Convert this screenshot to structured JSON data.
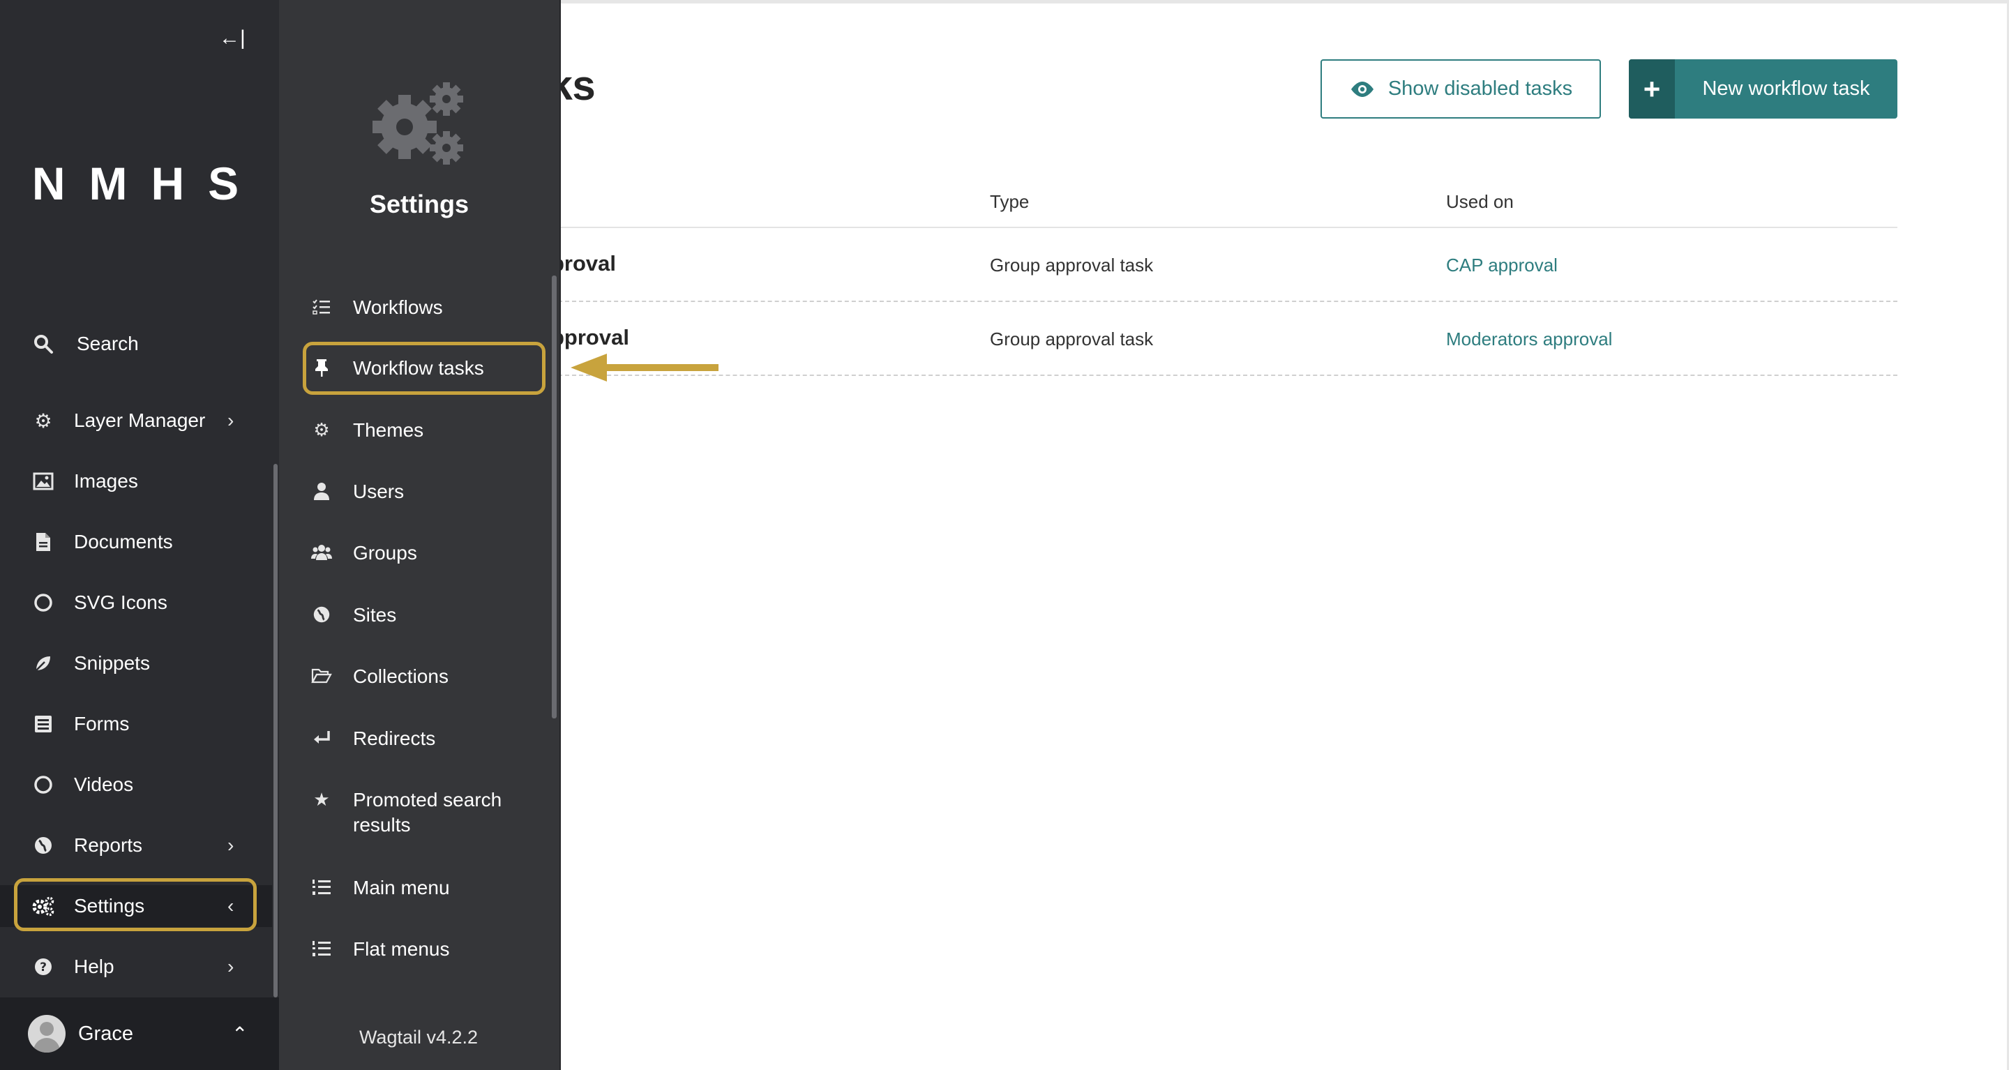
{
  "page": {
    "title": "w tasks",
    "show_disabled_label": "Show disabled tasks",
    "new_task_label": "New workflow task",
    "new_task_icon": "+"
  },
  "table": {
    "columns": [
      "Type",
      "Used on"
    ],
    "rows": [
      {
        "name": "proval",
        "type": "Group approval task",
        "used_on": "CAP approval"
      },
      {
        "name": "pproval",
        "type": "Group approval task",
        "used_on": "Moderators approval"
      }
    ]
  },
  "sidebar": {
    "collapse_icon": "←|",
    "logo": "NMHS",
    "items": [
      {
        "label": "Search",
        "icon": "search-icon"
      },
      {
        "label": "Layer Manager",
        "icon": "gear-icon",
        "chevron": "›"
      },
      {
        "label": "Images",
        "icon": "image-icon"
      },
      {
        "label": "Documents",
        "icon": "document-icon"
      },
      {
        "label": "SVG Icons",
        "icon": "circle-icon"
      },
      {
        "label": "Snippets",
        "icon": "snippet-icon"
      },
      {
        "label": "Forms",
        "icon": "form-icon"
      },
      {
        "label": "Videos",
        "icon": "circle-icon"
      },
      {
        "label": "Reports",
        "icon": "globe-icon",
        "chevron": "›"
      },
      {
        "label": "Settings",
        "icon": "gears-icon",
        "chevron": "‹"
      },
      {
        "label": "Help",
        "icon": "help-icon",
        "chevron": "›"
      }
    ],
    "account": {
      "name": "Grace",
      "chevron": "⌃"
    }
  },
  "submenu": {
    "title": "Settings",
    "items": [
      {
        "label": "Workflows"
      },
      {
        "label": "Workflow tasks"
      },
      {
        "label": "Themes"
      },
      {
        "label": "Users"
      },
      {
        "label": "Groups"
      },
      {
        "label": "Sites"
      },
      {
        "label": "Collections"
      },
      {
        "label": "Redirects"
      },
      {
        "label": "Promoted search results"
      },
      {
        "label": "Main menu"
      },
      {
        "label": "Flat menus"
      }
    ],
    "version": "Wagtail v4.2.2"
  },
  "colors": {
    "accent": "#2e7d7f",
    "sidebar_bg": "#2b2c30",
    "submenu_bg": "#353639",
    "highlight": "#c8a33d"
  }
}
